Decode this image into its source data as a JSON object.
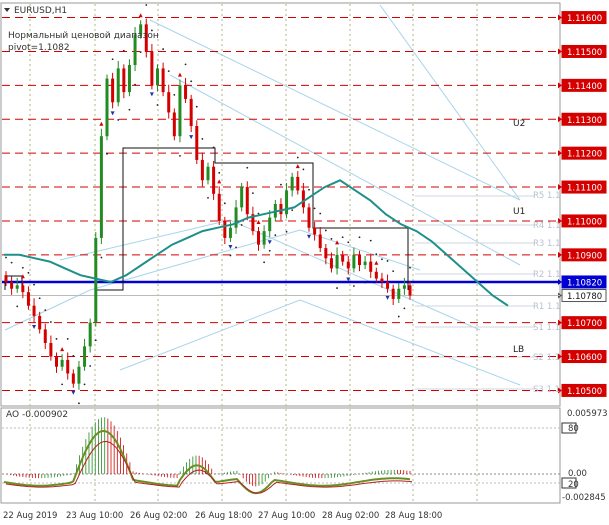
{
  "chart_header": {
    "symbol": "EURUSD,H1",
    "note_line1": "Нормальный ценовой диапазон",
    "note_line2": "pivot=1.1082"
  },
  "ao_header": {
    "label": "AO -0.000902"
  },
  "colors": {
    "grid_dash": "#d40000",
    "pivot_line": "#0000d0",
    "ma_line": "#1f8f8a",
    "up_candle": "#228b22",
    "down_candle": "#d40000",
    "price_tag": "#d40000",
    "pivot_tag": "#0000d0",
    "ao_line": "#6b8e23"
  },
  "chart_data": {
    "type": "candlestick",
    "symbol": "EURUSD",
    "timeframe": "H1",
    "price_levels": [
      "1.11600",
      "1.11500",
      "1.11400",
      "1.11300",
      "1.11200",
      "1.11100",
      "1.11000",
      "1.10900",
      "1.10820",
      "1.10780",
      "1.10700",
      "1.10600",
      "1.10500"
    ],
    "ylim": [
      1.1046,
      1.1164
    ],
    "pivot": "1.10820",
    "current_price": "1.10780",
    "channel_labels": [
      "U2",
      "U1",
      "LB"
    ],
    "level_labels": [
      "R5 1.1",
      "R4 1.1",
      "R3 1.1",
      "R2 1.1",
      "R1 1.1",
      "S1 1.1",
      "S2 1.1",
      "S3 1.1"
    ],
    "time_labels": [
      "22 Aug 2019",
      "23 Aug 10:00",
      "26 Aug 02:00",
      "26 Aug 18:00",
      "27 Aug 10:00",
      "28 Aug 02:00",
      "28 Aug 18:00"
    ],
    "close_series": [
      1.1082,
      1.108,
      1.1081,
      1.1079,
      1.1075,
      1.1072,
      1.1068,
      1.1064,
      1.106,
      1.1057,
      1.1059,
      1.1055,
      1.1052,
      1.1057,
      1.1063,
      1.107,
      1.1095,
      1.1125,
      1.1142,
      1.1135,
      1.1145,
      1.1138,
      1.1146,
      1.1155,
      1.1158,
      1.115,
      1.114,
      1.1145,
      1.1138,
      1.1132,
      1.1125,
      1.114,
      1.1136,
      1.1128,
      1.1118,
      1.1112,
      1.1116,
      1.1108,
      1.11,
      1.1095,
      1.1098,
      1.1104,
      1.111,
      1.1102,
      1.1097,
      1.1093,
      1.1097,
      1.1101,
      1.1105,
      1.1102,
      1.1109,
      1.1113,
      1.1109,
      1.1104,
      1.1098,
      1.1096,
      1.1092,
      1.1089,
      1.1086,
      1.109,
      1.1088,
      1.1086,
      1.109,
      1.1087,
      1.1088,
      1.1085,
      1.1083,
      1.1082,
      1.108,
      1.1077,
      1.108,
      1.1081,
      1.1078
    ],
    "ma_series": [
      1.109,
      1.109,
      1.1089,
      1.1088,
      1.1086,
      1.1084,
      1.1083,
      1.1082,
      1.1084,
      1.1087,
      1.109,
      1.1093,
      1.1095,
      1.1097,
      1.1098,
      1.1099,
      1.1101,
      1.1102,
      1.1103,
      1.1104,
      1.1107,
      1.111,
      1.1112,
      1.1109,
      1.1106,
      1.1102,
      1.1099,
      1.1097,
      1.1094,
      1.109,
      1.1086,
      1.1082,
      1.1078,
      1.1075
    ],
    "ao_indicator": {
      "label": "AO",
      "value": "-0.000902",
      "max": "0.005973",
      "min": "-0.002845",
      "zero": "0.00",
      "upper_level": "80",
      "lower_level": "20"
    }
  }
}
